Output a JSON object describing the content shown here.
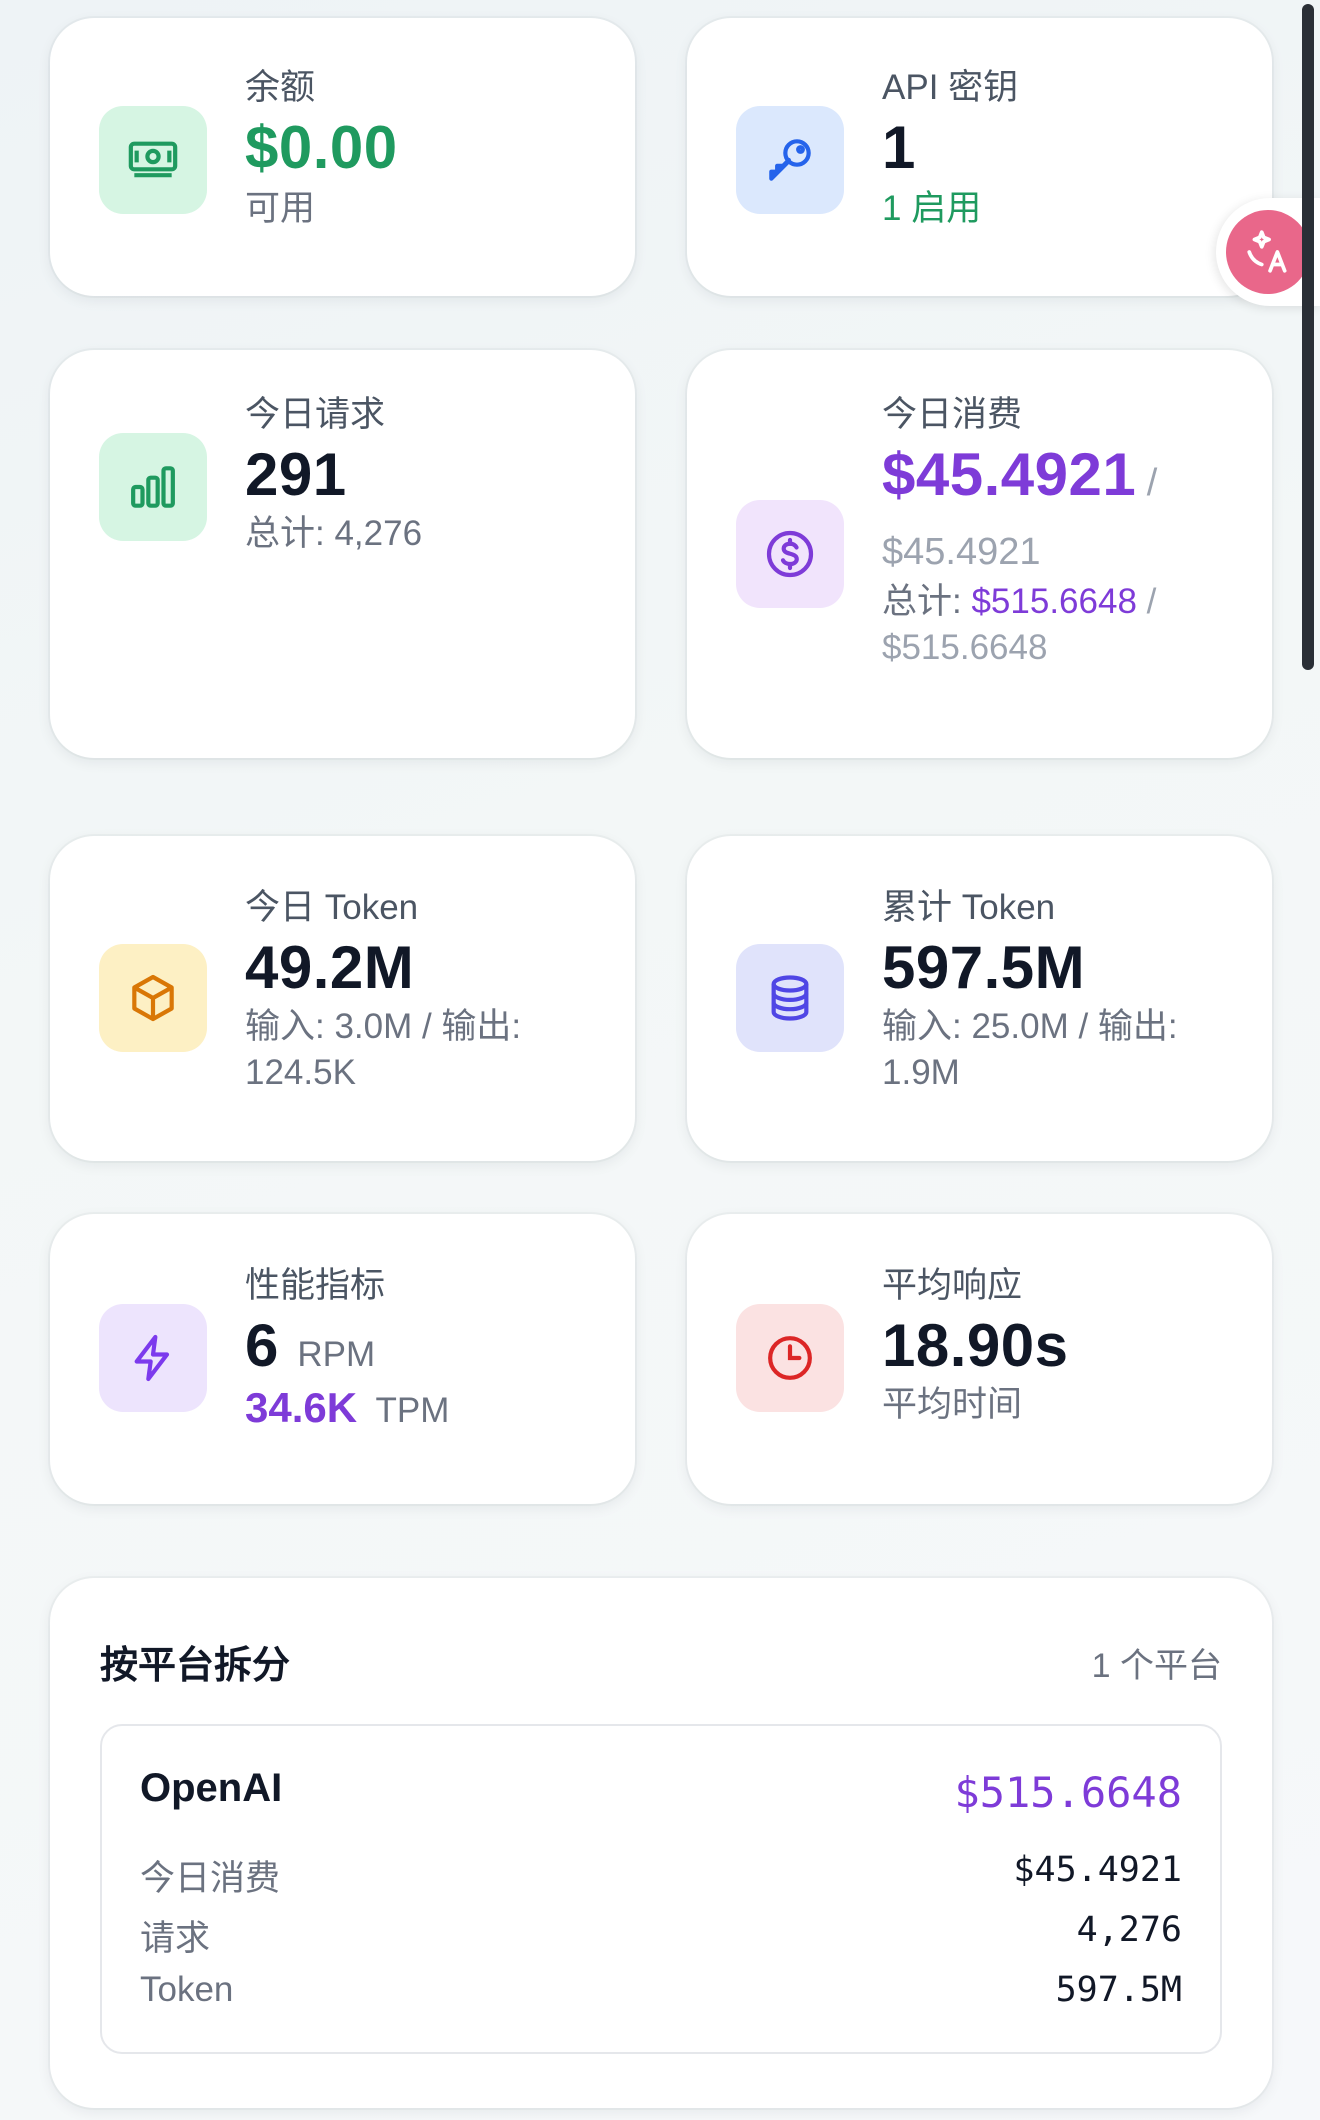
{
  "cards": {
    "balance": {
      "label": "余额",
      "value": "$0.00",
      "sub": "可用",
      "icon": "cash-icon"
    },
    "api_keys": {
      "label": "API 密钥",
      "value": "1",
      "sub": "1 启用",
      "icon": "key-icon"
    },
    "today_requests": {
      "label": "今日请求",
      "value": "291",
      "sub": "总计: 4,276",
      "icon": "bar-chart-icon"
    },
    "today_cost": {
      "label": "今日消费",
      "value": "$45.4921",
      "slash": "/",
      "value_limit": "$45.4921",
      "total_label": "总计:",
      "total_value": "$515.6648",
      "total_slash": "/",
      "total_limit": "$515.6648",
      "icon": "dollar-circle-icon"
    },
    "today_token": {
      "label": "今日 Token",
      "value": "49.2M",
      "sub": "输入: 3.0M / 输出: 124.5K",
      "icon": "cube-icon"
    },
    "total_token": {
      "label": "累计 Token",
      "value": "597.5M",
      "sub": "输入: 25.0M / 输出: 1.9M",
      "icon": "database-icon"
    },
    "performance": {
      "label": "性能指标",
      "rpm_value": "6",
      "rpm_unit": "RPM",
      "tpm_value": "34.6K",
      "tpm_unit": "TPM",
      "icon": "lightning-icon"
    },
    "avg_response": {
      "label": "平均响应",
      "value": "18.90s",
      "sub": "平均时间",
      "icon": "clock-icon"
    }
  },
  "platform_breakdown": {
    "title": "按平台拆分",
    "count": "1 个平台",
    "platforms": [
      {
        "name": "OpenAI",
        "total": "$515.6648",
        "rows": [
          {
            "label": "今日消费",
            "value": "$45.4921"
          },
          {
            "label": "请求",
            "value": "4,276"
          },
          {
            "label": "Token",
            "value": "597.5M"
          }
        ]
      }
    ]
  },
  "colors": {
    "green": "#1f9a5f",
    "purple": "#7e3bd8",
    "blue": "#2563eb",
    "orange": "#d97706",
    "indigo": "#4f46e5",
    "violet": "#7c3aed",
    "red": "#dc2626",
    "translate": "#e9678a"
  }
}
